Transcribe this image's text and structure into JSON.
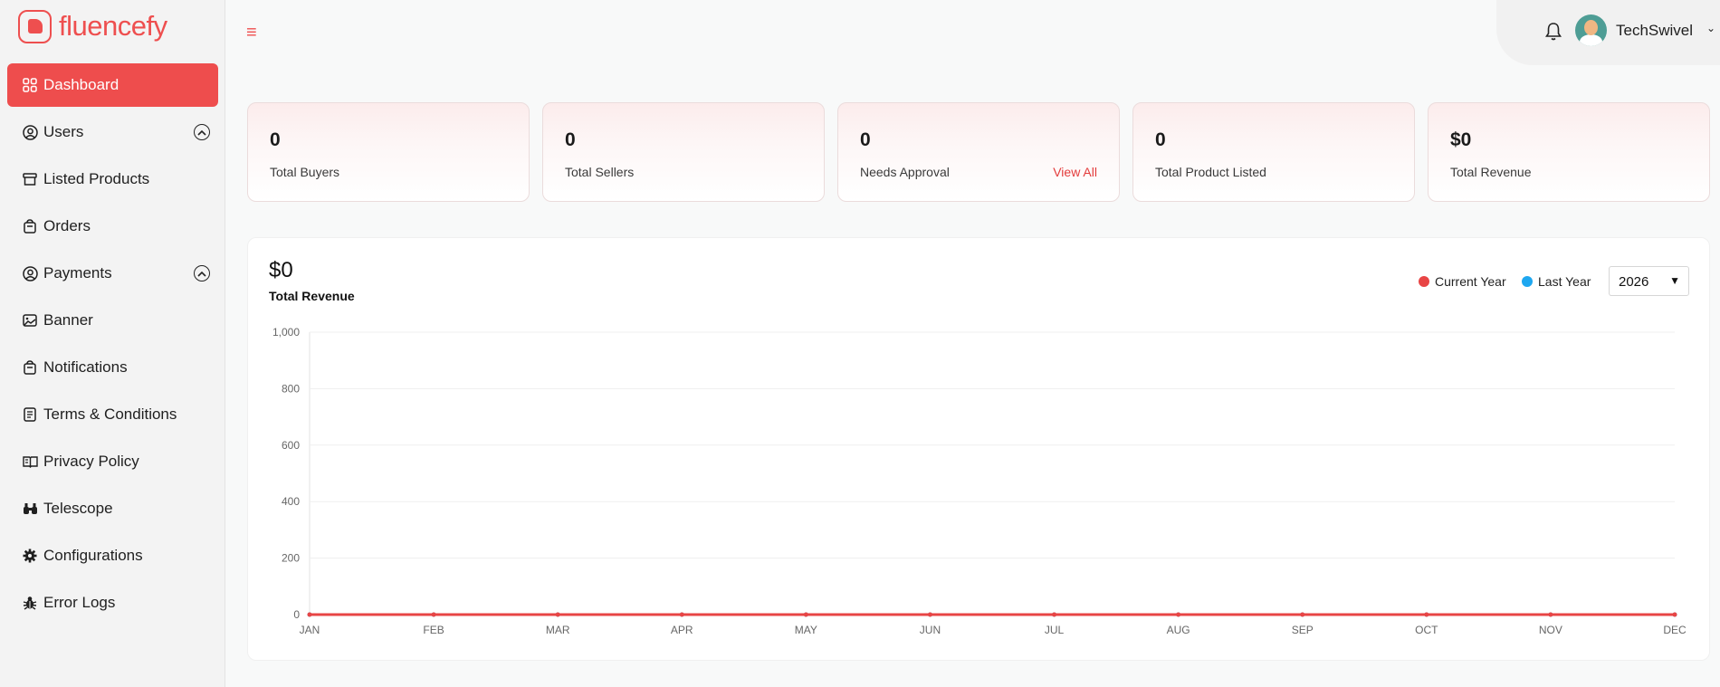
{
  "app": {
    "name": "fluencefy"
  },
  "sidebar": {
    "items": [
      {
        "label": "Dashboard",
        "icon": "grid-icon",
        "active": true
      },
      {
        "label": "Users",
        "icon": "user-circle-icon",
        "expandable": true
      },
      {
        "label": "Listed Products",
        "icon": "archive-icon"
      },
      {
        "label": "Orders",
        "icon": "bag-icon"
      },
      {
        "label": "Payments",
        "icon": "user-circle-icon",
        "expandable": true
      },
      {
        "label": "Banner",
        "icon": "image-icon"
      },
      {
        "label": "Notifications",
        "icon": "bag-icon"
      },
      {
        "label": "Terms & Conditions",
        "icon": "document-icon"
      },
      {
        "label": "Privacy Policy",
        "icon": "book-icon"
      },
      {
        "label": "Telescope",
        "icon": "binoculars-icon"
      },
      {
        "label": "Configurations",
        "icon": "gear-icon"
      },
      {
        "label": "Error Logs",
        "icon": "bug-icon"
      }
    ]
  },
  "header": {
    "username": "TechSwivel"
  },
  "stats": [
    {
      "value": "0",
      "label": "Total Buyers"
    },
    {
      "value": "0",
      "label": "Total Sellers"
    },
    {
      "value": "0",
      "label": "Needs Approval",
      "link": "View All"
    },
    {
      "value": "0",
      "label": "Total Product Listed"
    },
    {
      "value": "$0",
      "label": "Total Revenue"
    }
  ],
  "revenue": {
    "amount": "$0",
    "label": "Total Revenue",
    "year": "2026",
    "legend": {
      "current": "Current Year",
      "last": "Last Year"
    }
  },
  "colors": {
    "accent": "#ee4d4d",
    "current_year": "#e84545",
    "last_year": "#1ea7f0"
  },
  "chart_data": {
    "type": "line",
    "categories": [
      "JAN",
      "FEB",
      "MAR",
      "APR",
      "MAY",
      "JUN",
      "JUL",
      "AUG",
      "SEP",
      "OCT",
      "NOV",
      "DEC"
    ],
    "series": [
      {
        "name": "Current Year",
        "values": [
          0,
          0,
          0,
          0,
          0,
          0,
          0,
          0,
          0,
          0,
          0,
          0
        ]
      },
      {
        "name": "Last Year",
        "values": [
          0,
          0,
          0,
          0,
          0,
          0,
          0,
          0,
          0,
          0,
          0,
          0
        ]
      }
    ],
    "yticks": [
      "0",
      "200",
      "400",
      "600",
      "800",
      "1,000"
    ],
    "ylim": [
      0,
      1000
    ],
    "grid": true,
    "legend": "top-right"
  }
}
